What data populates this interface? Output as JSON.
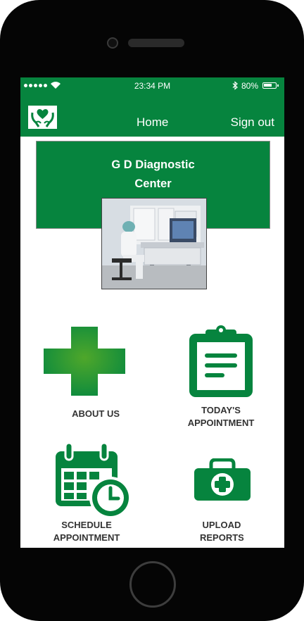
{
  "status_bar": {
    "time": "23:34 PM",
    "battery": "80%",
    "battery_level": 0.8
  },
  "nav": {
    "title": "Home",
    "sign_out": "Sign out"
  },
  "banner": {
    "name_line1": "G D Diagnostic",
    "name_line2": "Center"
  },
  "tiles": {
    "about": {
      "label": "ABOUT US",
      "icon": "medical-cross-icon"
    },
    "todays": {
      "label_line1": "TODAY'S",
      "label_line2": "APPOINTMENT",
      "icon": "clipboard-icon"
    },
    "schedule": {
      "label_line1": "SCHEDULE",
      "label_line2": "APPOINTMENT",
      "icon": "calendar-clock-icon"
    },
    "upload": {
      "label_line1": "UPLOAD",
      "label_line2": "REPORTS",
      "icon": "medical-kit-icon"
    }
  },
  "colors": {
    "brand_green": "#06843e",
    "text_dark": "#333333",
    "white": "#ffffff"
  }
}
